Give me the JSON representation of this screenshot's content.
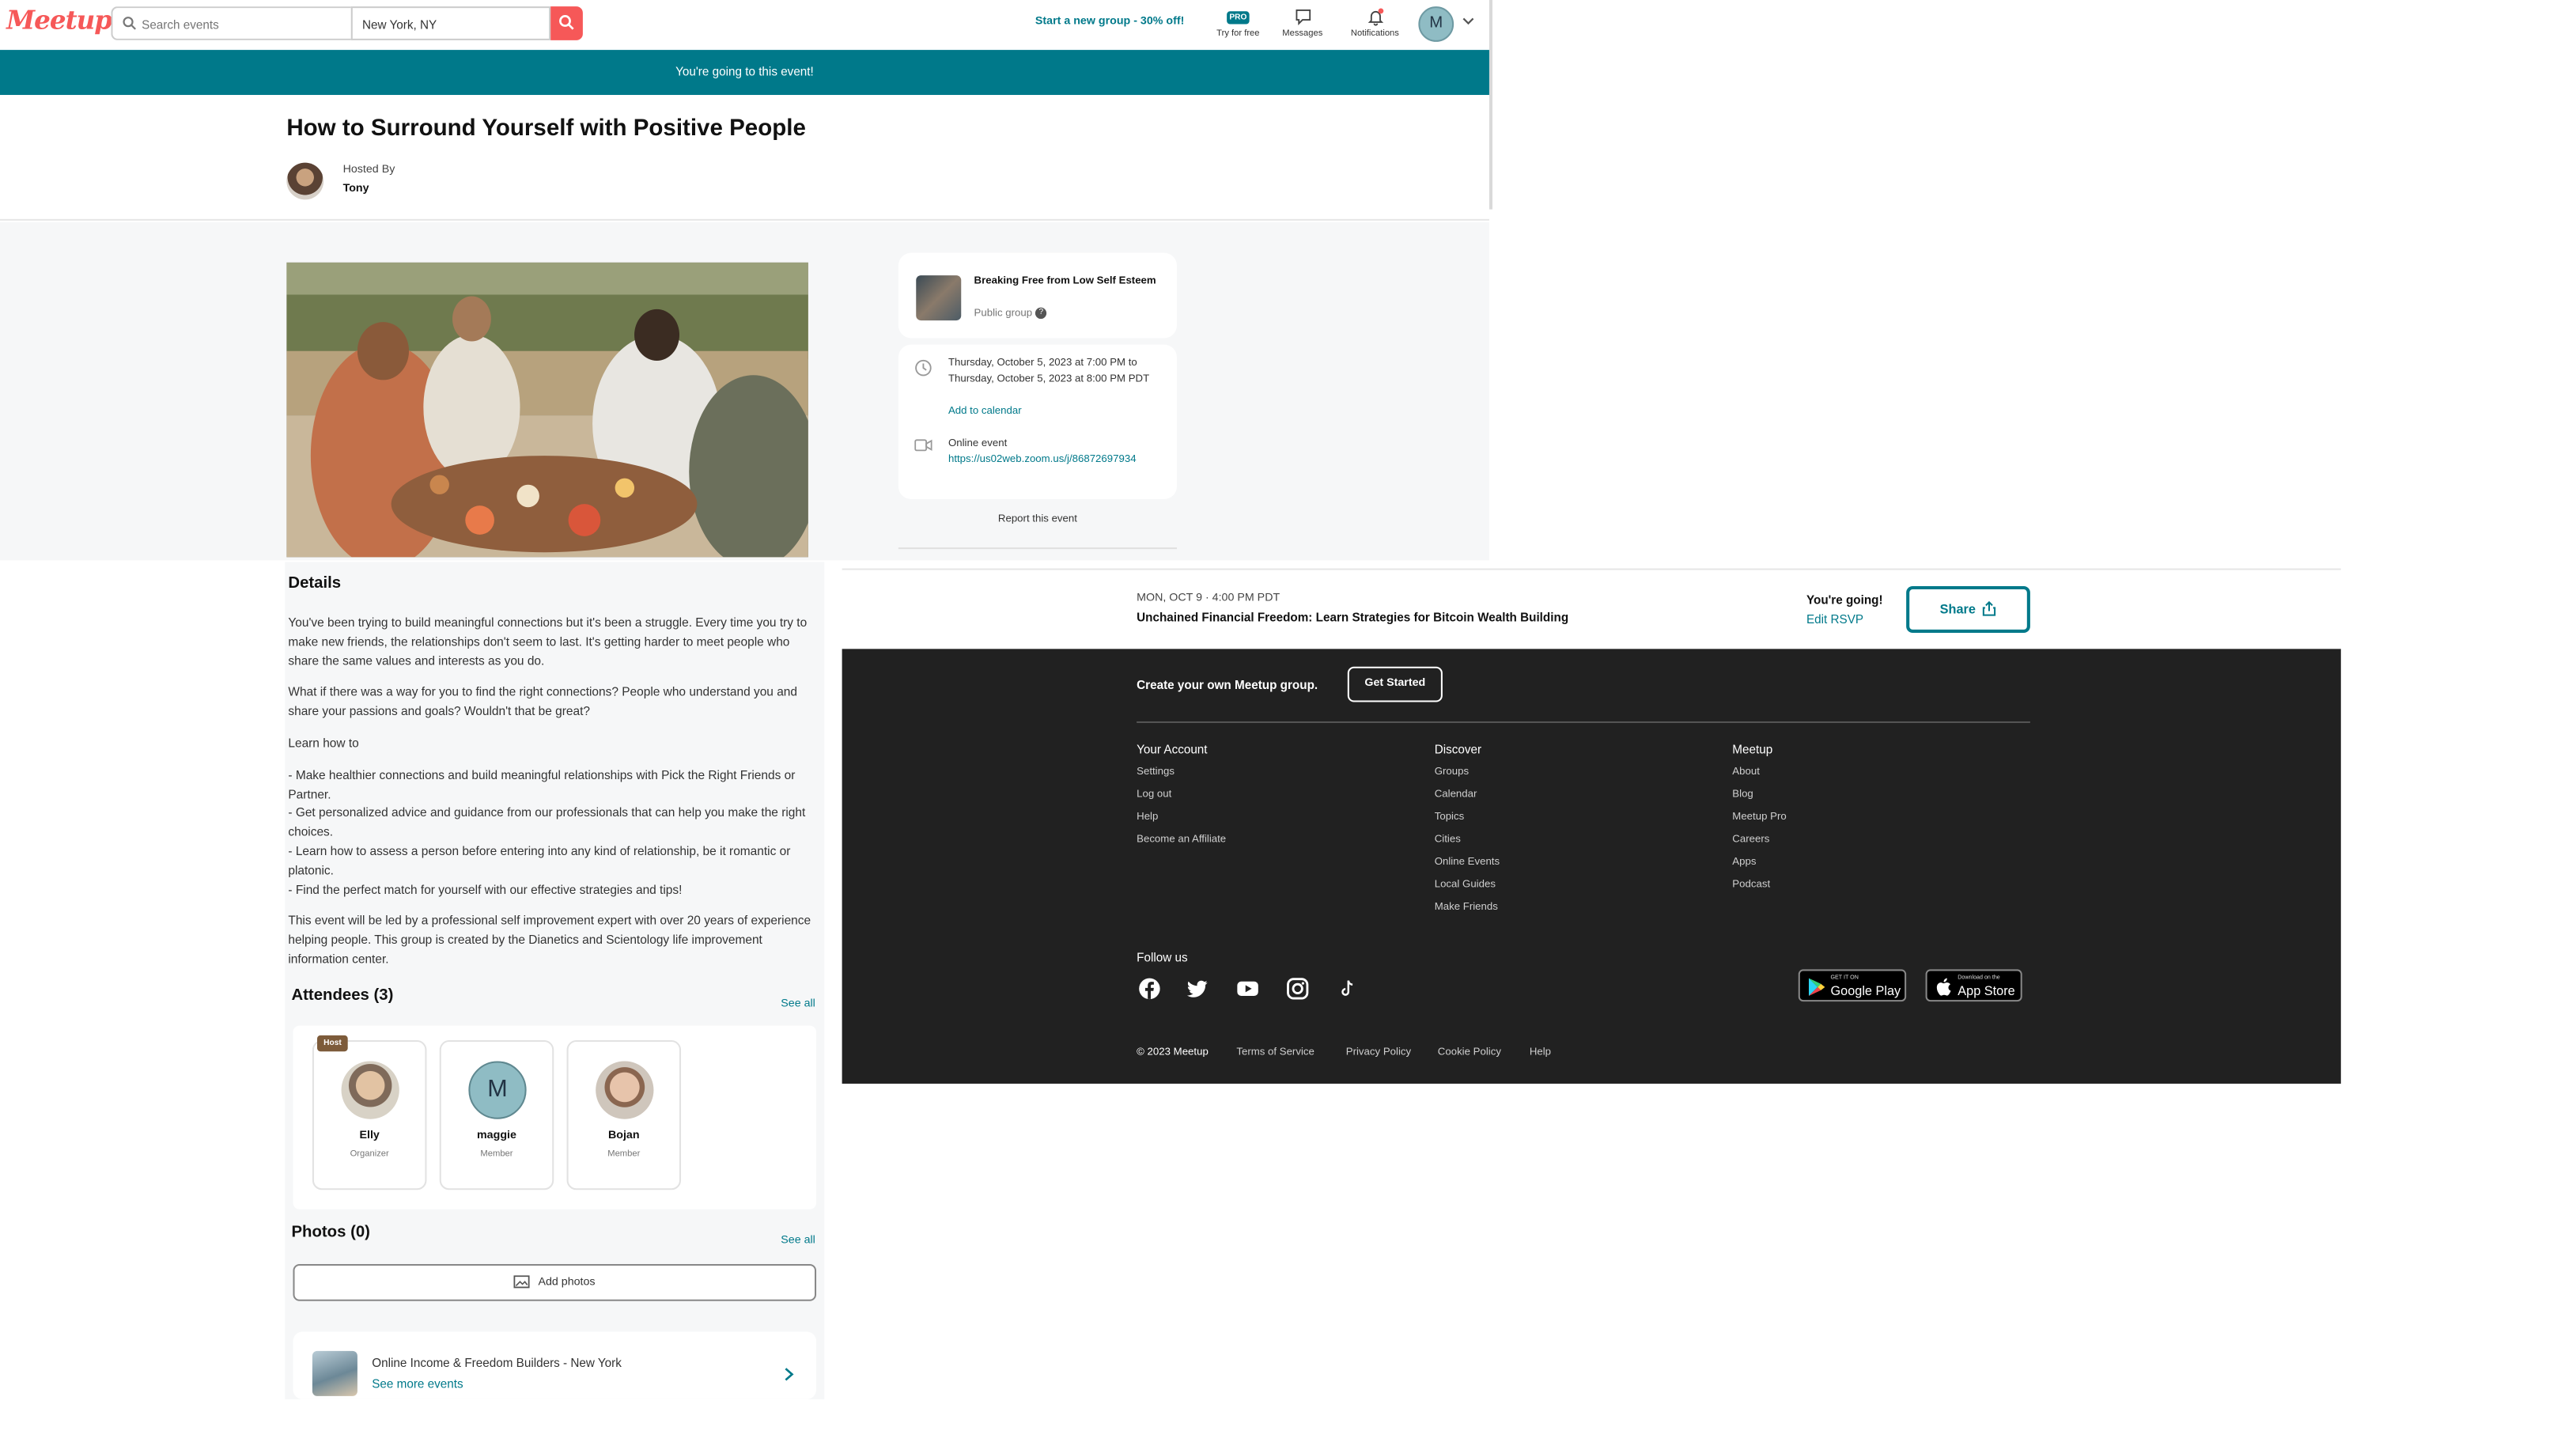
{
  "nav": {
    "logo": "Meetup",
    "search_placeholder": "Search events",
    "location_value": "New York, NY",
    "promo": "Start a new group - 30% off!",
    "pro_badge": "PRO",
    "try_label": "Try for free",
    "messages_label": "Messages",
    "notifications_label": "Notifications",
    "avatar_initial": "M"
  },
  "banner": {
    "text": "You're going to this event!"
  },
  "event": {
    "title": "How to Surround Yourself with Positive People",
    "hosted_by_label": "Hosted By",
    "host_name": "Tony"
  },
  "group_card": {
    "name": "Breaking Free from Low Self Esteem",
    "type": "Public group",
    "help": "?"
  },
  "time_card": {
    "datetime": "Thursday, October 5, 2023 at 7:00 PM to Thursday, October 5, 2023 at 8:00 PM PDT",
    "add_calendar": "Add to calendar",
    "online_label": "Online event",
    "zoom_url": "https://us02web.zoom.us/j/86872697934"
  },
  "report": "Report this event",
  "details": {
    "heading": "Details",
    "p1": "You've been trying to build meaningful connections but it's been a struggle. Every time you try to make new friends, the relationships don't seem to last. It's getting harder to meet people who share the same values and interests as you do.",
    "p2": "What if there was a way for you to find the right connections? People who understand you and share your passions and goals? Wouldn't that be great?",
    "p3": "Learn how to",
    "bullets": [
      "- Make healthier connections and build meaningful relationships with Pick the Right Friends or Partner.",
      "- Get personalized advice and guidance from our professionals that can help you make the right choices.",
      "- Learn how to assess a person before entering into any kind of relationship, be it romantic or platonic.",
      "- Find the perfect match for yourself with our effective strategies and tips!"
    ],
    "p4": "This event will be led by a professional self improvement expert with over 20 years of experience helping people. This group is created by the Dianetics and Scientology life improvement information center."
  },
  "attendees": {
    "heading": "Attendees (3)",
    "see_all": "See all",
    "host_tag": "Host",
    "people": [
      {
        "name": "Elly",
        "role": "Organizer"
      },
      {
        "name": "maggie",
        "role": "Member",
        "initial": "M"
      },
      {
        "name": "Bojan",
        "role": "Member"
      }
    ]
  },
  "photos": {
    "heading": "Photos (0)",
    "see_all": "See all",
    "add_label": "Add photos"
  },
  "group_more": {
    "name": "Online Income & Freedom Builders - New York",
    "link": "See more events"
  },
  "sticky": {
    "date": "MON, OCT 9 · 4:00 PM PDT",
    "title": "Unchained Financial Freedom: Learn Strategies for Bitcoin Wealth Building",
    "going": "You're going!",
    "edit": "Edit RSVP",
    "share": "Share"
  },
  "footer": {
    "create_text": "Create your own Meetup group.",
    "get_started": "Get Started",
    "columns": [
      {
        "heading": "Your Account",
        "items": [
          "Settings",
          "Log out",
          "Help",
          "Become an Affiliate"
        ]
      },
      {
        "heading": "Discover",
        "items": [
          "Groups",
          "Calendar",
          "Topics",
          "Cities",
          "Online Events",
          "Local Guides",
          "Make Friends"
        ]
      },
      {
        "heading": "Meetup",
        "items": [
          "About",
          "Blog",
          "Meetup Pro",
          "Careers",
          "Apps",
          "Podcast"
        ]
      }
    ],
    "follow_us": "Follow us",
    "google_small": "GET IT ON",
    "google_big": "Google Play",
    "apple_small": "Download on the",
    "apple_big": "App Store",
    "copyright": "© 2023 Meetup",
    "legal": [
      "Terms of Service",
      "Privacy Policy",
      "Cookie Policy",
      "Help"
    ]
  },
  "colors": {
    "brand": "#f65858",
    "teal": "#00798a",
    "footer_bg": "#212121"
  }
}
